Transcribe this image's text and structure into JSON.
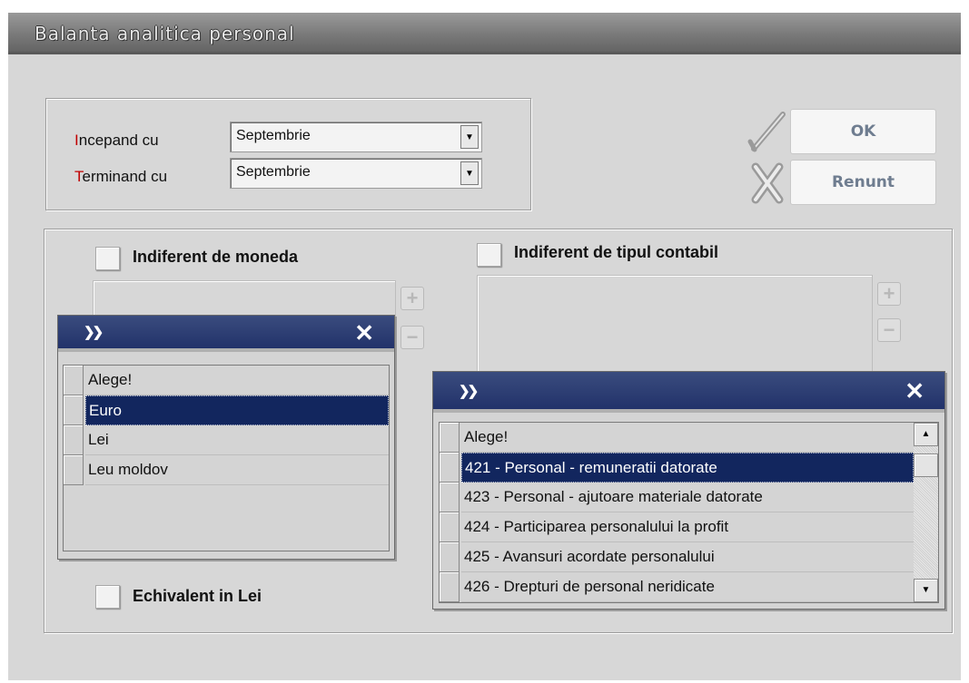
{
  "window": {
    "title": "Balanta analitica personal"
  },
  "period": {
    "start_label_hot": "I",
    "start_label_rest": "ncepand cu",
    "start_value": "Septembrie",
    "end_label_hot": "T",
    "end_label_rest": "erminand cu",
    "end_value": "Septembrie"
  },
  "buttons": {
    "ok": "OK",
    "cancel": "Renunt"
  },
  "currency": {
    "checkbox_label": "Indiferent de moneda",
    "popup_chevron": "»",
    "items": [
      "Alege!",
      "Euro",
      "Lei",
      "Leu moldov"
    ],
    "selected_index": 1
  },
  "account_type": {
    "checkbox_label": "Indiferent de tipul contabil",
    "popup_chevron": "»",
    "items": [
      "Alege!",
      "421 - Personal - remuneratii datorate",
      "423 - Personal - ajutoare materiale datorate",
      "424 - Participarea personalului la profit",
      "425 - Avansuri acordate personalului",
      "426 - Drepturi de personal neridicate"
    ],
    "selected_index": 1
  },
  "equivalent": {
    "checkbox_label": "Echivalent in Lei"
  },
  "icons": {
    "close": "✕",
    "plus": "+",
    "minus": "−",
    "ok": "check-icon",
    "cancel": "x-icon"
  }
}
